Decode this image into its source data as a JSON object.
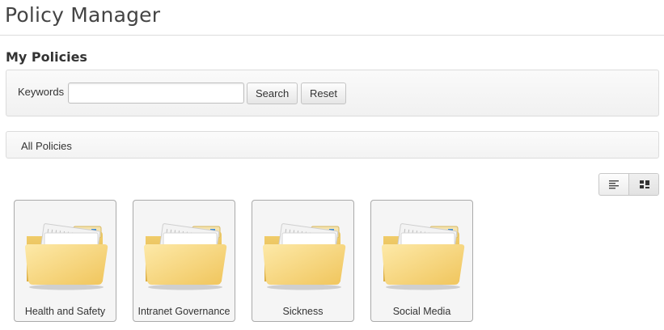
{
  "app": {
    "title": "Policy Manager"
  },
  "page": {
    "section_title": "My Policies"
  },
  "search": {
    "keywords_label": "Keywords",
    "keywords_value": "",
    "search_button": "Search",
    "reset_button": "Reset"
  },
  "breadcrumb": {
    "items": [
      "All Policies"
    ]
  },
  "view_toggle": {
    "options": [
      {
        "icon": "list-view-icon",
        "active": false
      },
      {
        "icon": "grid-view-icon",
        "active": true
      }
    ]
  },
  "folders": [
    {
      "label": "Health and Safety",
      "icon": "folder-icon"
    },
    {
      "label": "Intranet Governance",
      "icon": "folder-icon"
    },
    {
      "label": "Sickness",
      "icon": "folder-icon"
    },
    {
      "label": "Social Media",
      "icon": "folder-icon"
    }
  ],
  "colors": {
    "folder_front": "#f6d77f",
    "folder_back": "#e8bf55",
    "tile_border": "#aaaaaa",
    "panel_background": "#f5f5f5"
  }
}
